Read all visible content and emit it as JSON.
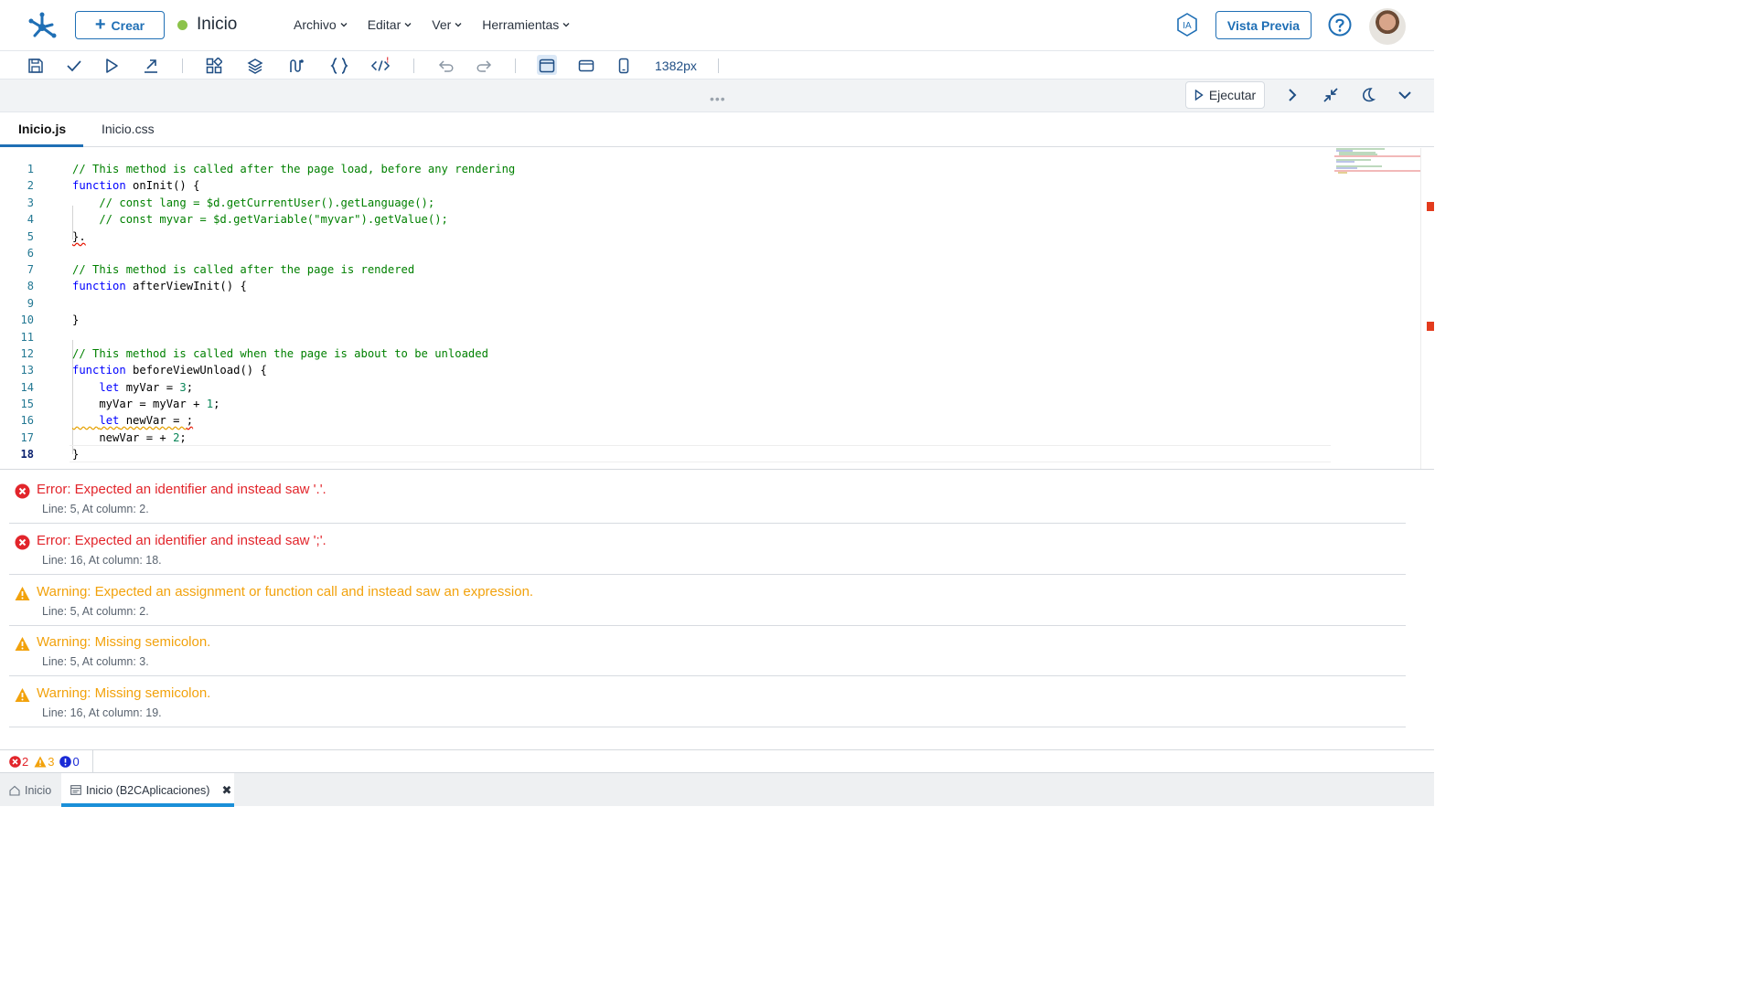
{
  "header": {
    "create_label": "Crear",
    "page_title": "Inicio",
    "status_color": "#8cc34a",
    "menus": [
      {
        "label": "Archivo"
      },
      {
        "label": "Editar"
      },
      {
        "label": "Ver"
      },
      {
        "label": "Herramientas"
      }
    ],
    "ia_label": "IA",
    "preview_label": "Vista Previa",
    "accent_color": "#1f6fb5"
  },
  "toolbar": {
    "icons": [
      "save-icon",
      "check-icon",
      "play-icon",
      "export-icon",
      "components-icon",
      "layers-icon",
      "variables-icon",
      "braces-icon",
      "code-icon",
      "undo-icon",
      "redo-icon",
      "desktop-view-icon",
      "tablet-view-icon",
      "mobile-view-icon"
    ],
    "width_label": "1382px"
  },
  "panel_bar": {
    "run_label": "Ejecutar",
    "icons": [
      "chevron-right-icon",
      "collapse-icon",
      "moon-icon",
      "chevron-down-icon"
    ]
  },
  "tabs": [
    {
      "label": "Inicio.js",
      "active": true
    },
    {
      "label": "Inicio.css",
      "active": false
    }
  ],
  "code_lines": [
    {
      "n": "1",
      "text": "// This method is called after the page load, before any rendering"
    },
    {
      "n": "2",
      "text": "function onInit() {"
    },
    {
      "n": "3",
      "text": "    // const lang = $d.getCurrentUser().getLanguage();"
    },
    {
      "n": "4",
      "text": "    // const myvar = $d.getVariable(\"myvar\").getValue();"
    },
    {
      "n": "5",
      "text": "}."
    },
    {
      "n": "6",
      "text": ""
    },
    {
      "n": "7",
      "text": "// This method is called after the page is rendered"
    },
    {
      "n": "8",
      "text": "function afterViewInit() {"
    },
    {
      "n": "9",
      "text": ""
    },
    {
      "n": "10",
      "text": "}"
    },
    {
      "n": "11",
      "text": ""
    },
    {
      "n": "12",
      "text": "// This method is called when the page is about to be unloaded"
    },
    {
      "n": "13",
      "text": "function beforeViewUnload() {"
    },
    {
      "n": "14",
      "text": "    let myVar = 3;"
    },
    {
      "n": "15",
      "text": "    myVar = myVar + 1;"
    },
    {
      "n": "16",
      "text": "    let newVar = ;"
    },
    {
      "n": "17",
      "text": "    newVar = + 2;"
    },
    {
      "n": "18",
      "text": "}"
    }
  ],
  "problems": [
    {
      "severity": "error",
      "message": "Error: Expected an identifier and instead saw '.'.",
      "location": "Line: 5, At column: 2."
    },
    {
      "severity": "error",
      "message": "Error: Expected an identifier and instead saw ';'.",
      "location": "Line: 16, At column: 18."
    },
    {
      "severity": "warning",
      "message": "Warning: Expected an assignment or function call and instead saw an expression.",
      "location": "Line: 5, At column: 2."
    },
    {
      "severity": "warning",
      "message": "Warning: Missing semicolon.",
      "location": "Line: 5, At column: 3."
    },
    {
      "severity": "warning",
      "message": "Warning: Missing semicolon.",
      "location": "Line: 16, At column: 19."
    }
  ],
  "status": {
    "errors": "2",
    "warnings": "3",
    "infos": "0",
    "error_color": "#e2252b",
    "warning_color": "#f2a20c",
    "info_color": "#1a2ad6"
  },
  "bottom_tabs": [
    {
      "label": "Inicio",
      "icon": "home-icon",
      "active": false
    },
    {
      "label": "Inicio (B2CAplicaciones)",
      "icon": "page-icon",
      "active": true
    }
  ]
}
